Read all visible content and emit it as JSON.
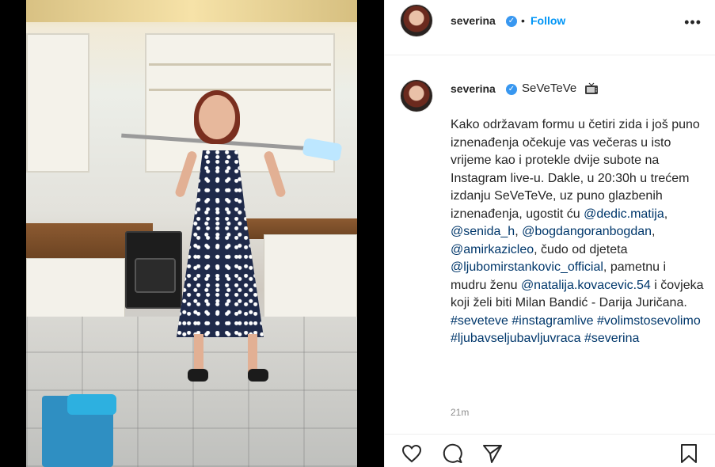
{
  "post": {
    "username": "severina",
    "verified_mark": "✓",
    "follow_label": "Follow",
    "separator": "•",
    "more_label": "•••",
    "caption_title": "SeVeTeVe",
    "caption_segments": [
      {
        "text": "Kako održavam formu u četiri zida i još puno iznenađenja očekuje vas večeras u isto vrijeme kao i protekle dvije subote na Instagram live-u. Dakle, u 20:30h u trećem izdanju SeVeTeVe, uz puno glazbenih iznenađenja, ugostit ću ",
        "type": "text"
      },
      {
        "text": "@dedic.matija",
        "type": "tag"
      },
      {
        "text": ", ",
        "type": "text"
      },
      {
        "text": "@senida_h",
        "type": "tag"
      },
      {
        "text": ", ",
        "type": "text"
      },
      {
        "text": "@bogdangoranbogdan",
        "type": "tag"
      },
      {
        "text": ", ",
        "type": "text"
      },
      {
        "text": "@amirkazicleo",
        "type": "tag"
      },
      {
        "text": ", čudo od djeteta ",
        "type": "text"
      },
      {
        "text": "@ljubomirstankovic_official",
        "type": "tag"
      },
      {
        "text": ", pametnu i mudru ženu ",
        "type": "text"
      },
      {
        "text": "@natalija.kovacevic.54",
        "type": "tag"
      },
      {
        "text": " i čovjeka koji želi biti Milan Bandić - Darija Juričana. ",
        "type": "text"
      },
      {
        "text": "#seveteve",
        "type": "tag"
      },
      {
        "text": " ",
        "type": "text"
      },
      {
        "text": "#instagramlive",
        "type": "tag"
      },
      {
        "text": " ",
        "type": "text"
      },
      {
        "text": "#volimstosevolimo",
        "type": "tag"
      },
      {
        "text": " ",
        "type": "text"
      },
      {
        "text": "#ljubavseljubavljuvraca",
        "type": "tag"
      },
      {
        "text": " ",
        "type": "text"
      },
      {
        "text": "#severina",
        "type": "tag"
      }
    ],
    "timestamp": "21m"
  },
  "actions": {
    "icons": [
      "heart-icon",
      "comment-icon",
      "share-icon",
      "bookmark-icon"
    ]
  },
  "colors": {
    "link": "#00376b",
    "follow": "#0095f6",
    "verified": "#3897f0",
    "muted": "#8e8e8e"
  }
}
